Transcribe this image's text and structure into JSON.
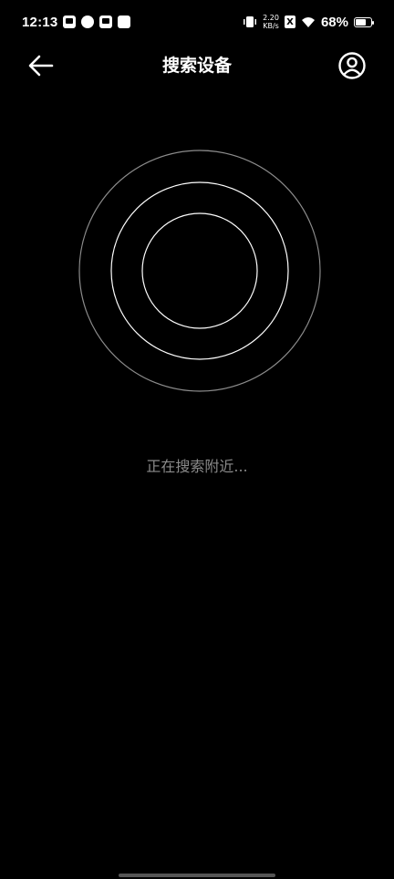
{
  "status_bar": {
    "time": "12:13",
    "net_speed_value": "2.20",
    "net_speed_unit": "KB/s",
    "sim_badge": "X",
    "battery_percent": "68%",
    "battery_level": 0.68,
    "icons": [
      "notification-icon-1",
      "notification-icon-2",
      "mail-icon",
      "notification-icon-4",
      "vibrate-icon",
      "wifi-icon",
      "battery-icon"
    ]
  },
  "header": {
    "title": "搜索设备",
    "back_icon": "arrow-left-icon",
    "account_icon": "user-circle-icon"
  },
  "radar": {
    "ring_color": "#8c8c8c",
    "inner_ring_color": "#ffffff"
  },
  "status": {
    "text": "正在搜索附近..."
  }
}
